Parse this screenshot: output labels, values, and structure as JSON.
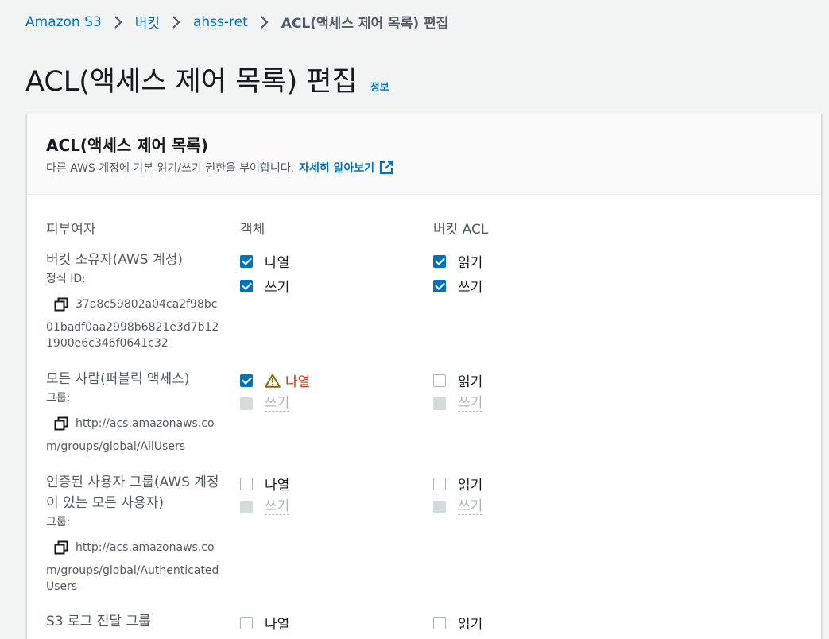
{
  "breadcrumb": {
    "items": [
      "Amazon S3",
      "버킷",
      "ahss-ret"
    ],
    "current": "ACL(액세스 제어 목록) 편집"
  },
  "page": {
    "title": "ACL(액세스 제어 목록) 편집",
    "info": "정보"
  },
  "panel": {
    "title": "ACL(액세스 제어 목록)",
    "description": "다른 AWS 계정에 기본 읽기/쓰기 권한을 부여합니다.",
    "learn_more": "자세히 알아보기"
  },
  "columns": {
    "grantee": "피부여자",
    "object": "객체",
    "bucket_acl": "버킷 ACL"
  },
  "grantees": [
    {
      "name": "버킷 소유자(AWS 계정)",
      "type_label": "정식 ID:",
      "id_first": "37a8c59802a04ca2f98bc",
      "id_rest": "01badf0aa2998b6821e3d7b12 1900e6c346f0641c32",
      "object": [
        {
          "label": "나열",
          "state": "checked"
        },
        {
          "label": "쓰기",
          "state": "checked"
        }
      ],
      "bucket_acl": [
        {
          "label": "읽기",
          "state": "checked"
        },
        {
          "label": "쓰기",
          "state": "checked"
        }
      ]
    },
    {
      "name": "모든 사람(퍼블릭 액세스)",
      "type_label": "그룹:",
      "id_first": "http://acs.amazonaws.co",
      "id_rest": "m/groups/global/AllUsers",
      "object": [
        {
          "label": "나열",
          "state": "checked-warning"
        },
        {
          "label": "쓰기",
          "state": "disabled"
        }
      ],
      "bucket_acl": [
        {
          "label": "읽기",
          "state": "unchecked"
        },
        {
          "label": "쓰기",
          "state": "disabled"
        }
      ]
    },
    {
      "name": "인증된 사용자 그룹(AWS 계정이 있는 모든 사용자)",
      "type_label": "그룹:",
      "id_first": "http://acs.amazonaws.co",
      "id_rest": "m/groups/global/Authenticated Users",
      "object": [
        {
          "label": "나열",
          "state": "unchecked"
        },
        {
          "label": "쓰기",
          "state": "disabled"
        }
      ],
      "bucket_acl": [
        {
          "label": "읽기",
          "state": "unchecked"
        },
        {
          "label": "쓰기",
          "state": "disabled"
        }
      ]
    },
    {
      "name": "S3 로그 전달 그룹",
      "object": [
        {
          "label": "나열",
          "state": "unchecked"
        }
      ],
      "bucket_acl": [
        {
          "label": "읽기",
          "state": "unchecked"
        }
      ]
    }
  ],
  "colors": {
    "link": "#0073bb",
    "checkbox": "#0073bb",
    "warning_text": "#d13212",
    "warning_icon": "#8d6605"
  }
}
